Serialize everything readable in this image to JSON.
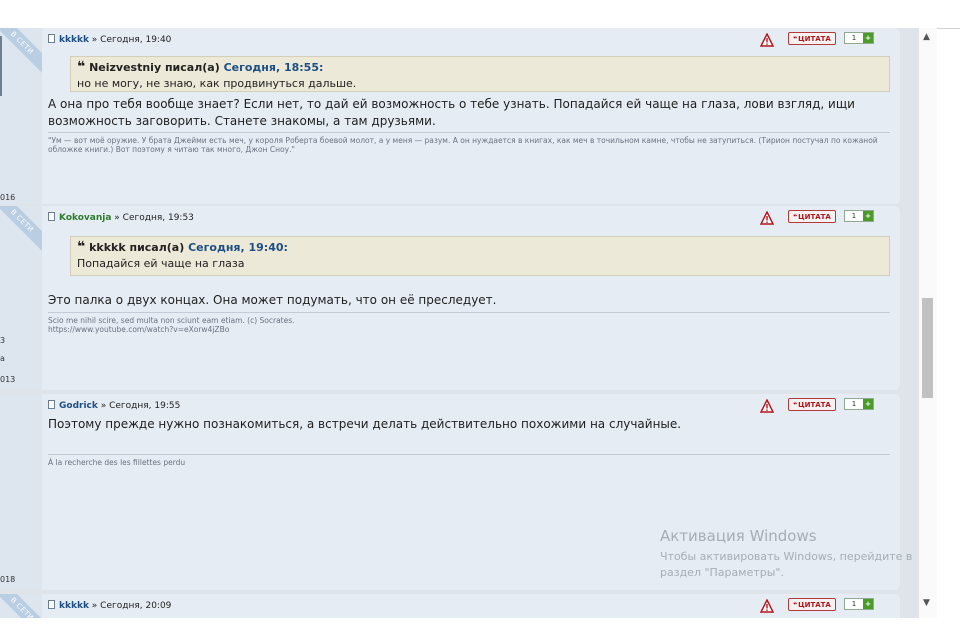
{
  "actions": {
    "quote_label": "ЦИТАТА",
    "quote_mark": "❝"
  },
  "posts": [
    {
      "author": "kkkkk",
      "sep": " » ",
      "time": "Сегодня, 19:40",
      "online": "В СЕТИ",
      "year_frag": "016",
      "rating": "1",
      "quote": {
        "author": "Neizvestniy писал(а)",
        "date": "Сегодня, 18:55:",
        "text": "но не могу, не знаю, как продвинуться дальше."
      },
      "message": "А она про тебя вообще знает? Если нет, то дай ей возможность о тебе узнать. Попадайся ей чаще на глаза, лови взгляд, ищи возможность заговорить. Станете знакомы, а там друзьями.",
      "signature": "\"Ум — вот моё оружие. У брата Джейми есть меч, у короля Роберта боевой молот, а у меня — разум. А он нуждается в книгах, как меч в точильном камне, чтобы не затупиться. (Тирион постучал по кожаной обложке книги.) Вот поэтому я читаю так много, Джон Сноу.\""
    },
    {
      "author": "Kokovanja",
      "sep": " » ",
      "time": "Сегодня, 19:53",
      "online": "В СЕТИ",
      "year_frag": "013",
      "side_frag_1": "a",
      "side_frag_2": "3",
      "rating": "1",
      "quote": {
        "author": "kkkkk писал(а)",
        "date": "Сегодня, 19:40:",
        "text": "Попадайся ей чаще на глаза"
      },
      "message": "Это палка о двух концах. Она может подумать, что он её преследует.",
      "signature_1": "Scio me nihil scire, sed multa non sciunt eam etiam. (c) Socrates.",
      "signature_2": "https://www.youtube.com/watch?v=eXorw4jZBo"
    },
    {
      "author": "Godrick",
      "sep": " » ",
      "time": "Сегодня, 19:55",
      "year_frag": "018",
      "rating": "1",
      "message": "Поэтому прежде нужно познакомиться, а встречи делать действительно похожими на случайные.",
      "signature": "À la recherche des les fillettes perdu"
    },
    {
      "author": "kkkkk",
      "sep": " » ",
      "time": "Сегодня, 20:09",
      "online": "В СЕТИ",
      "rating": "1"
    }
  ],
  "watermark": {
    "title": "Активация Windows",
    "text": "Чтобы активировать Windows, перейдите в раздел \"Параметры\"."
  },
  "colors": {
    "accent": "#1d4f85",
    "author_green": "#2d7d2d",
    "quote_red": "#b3141b",
    "plus_green": "#4b9b28"
  }
}
